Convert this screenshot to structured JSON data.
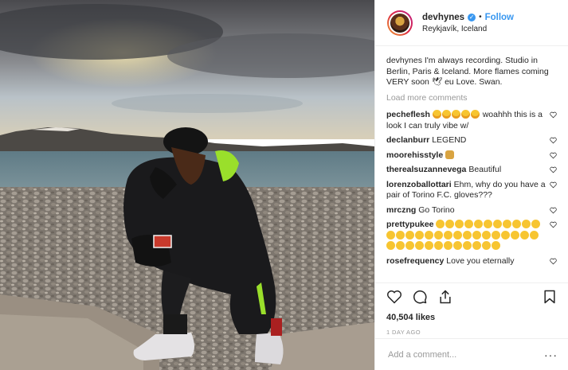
{
  "header": {
    "username": "devhynes",
    "separator": "•",
    "follow_label": "Follow",
    "location": "Reykjavík, Iceland"
  },
  "caption": {
    "username": "devhynes",
    "text": "I'm always recording. Studio in Berlin, Paris & Iceland. More flames coming VERY soon 🕊 eu Love. Swan."
  },
  "load_more_label": "Load more comments",
  "comments": [
    {
      "username": "pecheflesh",
      "text": "woahhh this is a look I can truly vibe w/",
      "emoji": "heart-eyes-emoji",
      "emoji_count": 5
    },
    {
      "username": "declanburr",
      "text": "LEGEND"
    },
    {
      "username": "moorehisstyle",
      "text": "",
      "emoji": "raising-hands-emoji",
      "emoji_count": 1
    },
    {
      "username": "therealsuzannevega",
      "text": "Beautiful"
    },
    {
      "username": "lorenzoballottari",
      "text": "Ehm, why do you have a pair of Torino F.C. gloves???"
    },
    {
      "username": "mrczng",
      "text": "Go Torino"
    },
    {
      "username": "prettypukee",
      "text": "",
      "emoji": "shocked-face-emoji",
      "emoji_count": 39
    },
    {
      "username": "rosefrequency",
      "text": "Love you eternally"
    }
  ],
  "likes": "40,504 likes",
  "time": "1 DAY AGO",
  "add_comment": {
    "placeholder": "Add a comment..."
  },
  "icons": {
    "like": "heart-icon",
    "comment": "speech-bubble-icon",
    "share": "share-icon",
    "save": "bookmark-icon",
    "options": "more-dots-icon"
  },
  "colors": {
    "accent": "#3897f0",
    "text": "#262626",
    "muted": "#999999",
    "border": "#efefef"
  }
}
